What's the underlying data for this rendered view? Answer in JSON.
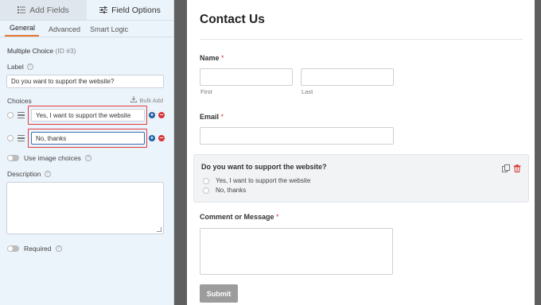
{
  "left_panel": {
    "tabs": [
      {
        "label": "Add Fields",
        "icon": "list-icon",
        "active": false
      },
      {
        "label": "Field Options",
        "icon": "sliders-icon",
        "active": true
      }
    ],
    "subtabs": [
      "General",
      "Advanced",
      "Smart Logic"
    ],
    "active_subtab": "General",
    "field_type": "Multiple Choice",
    "field_id": "(ID #3)",
    "label_caption": "Label",
    "label_value": "Do you want to support the website?",
    "choices_caption": "Choices",
    "bulk_add": "Bulk Add",
    "choices": [
      {
        "value": "Yes, I want to support the website"
      },
      {
        "value": "No, thanks"
      }
    ],
    "image_choices_label": "Use image choices",
    "description_caption": "Description",
    "description_value": "",
    "required_label": "Required",
    "accent_color": "#e27730",
    "highlight_color": "#e03a3a"
  },
  "form": {
    "title": "Contact Us",
    "name_label": "Name",
    "first_sub": "First",
    "last_sub": "Last",
    "email_label": "Email",
    "question_label": "Do you want to support the website?",
    "options": [
      "Yes, I want to support the website",
      "No, thanks"
    ],
    "message_label": "Comment or Message",
    "required_mark": "*",
    "submit_label": "Submit"
  }
}
